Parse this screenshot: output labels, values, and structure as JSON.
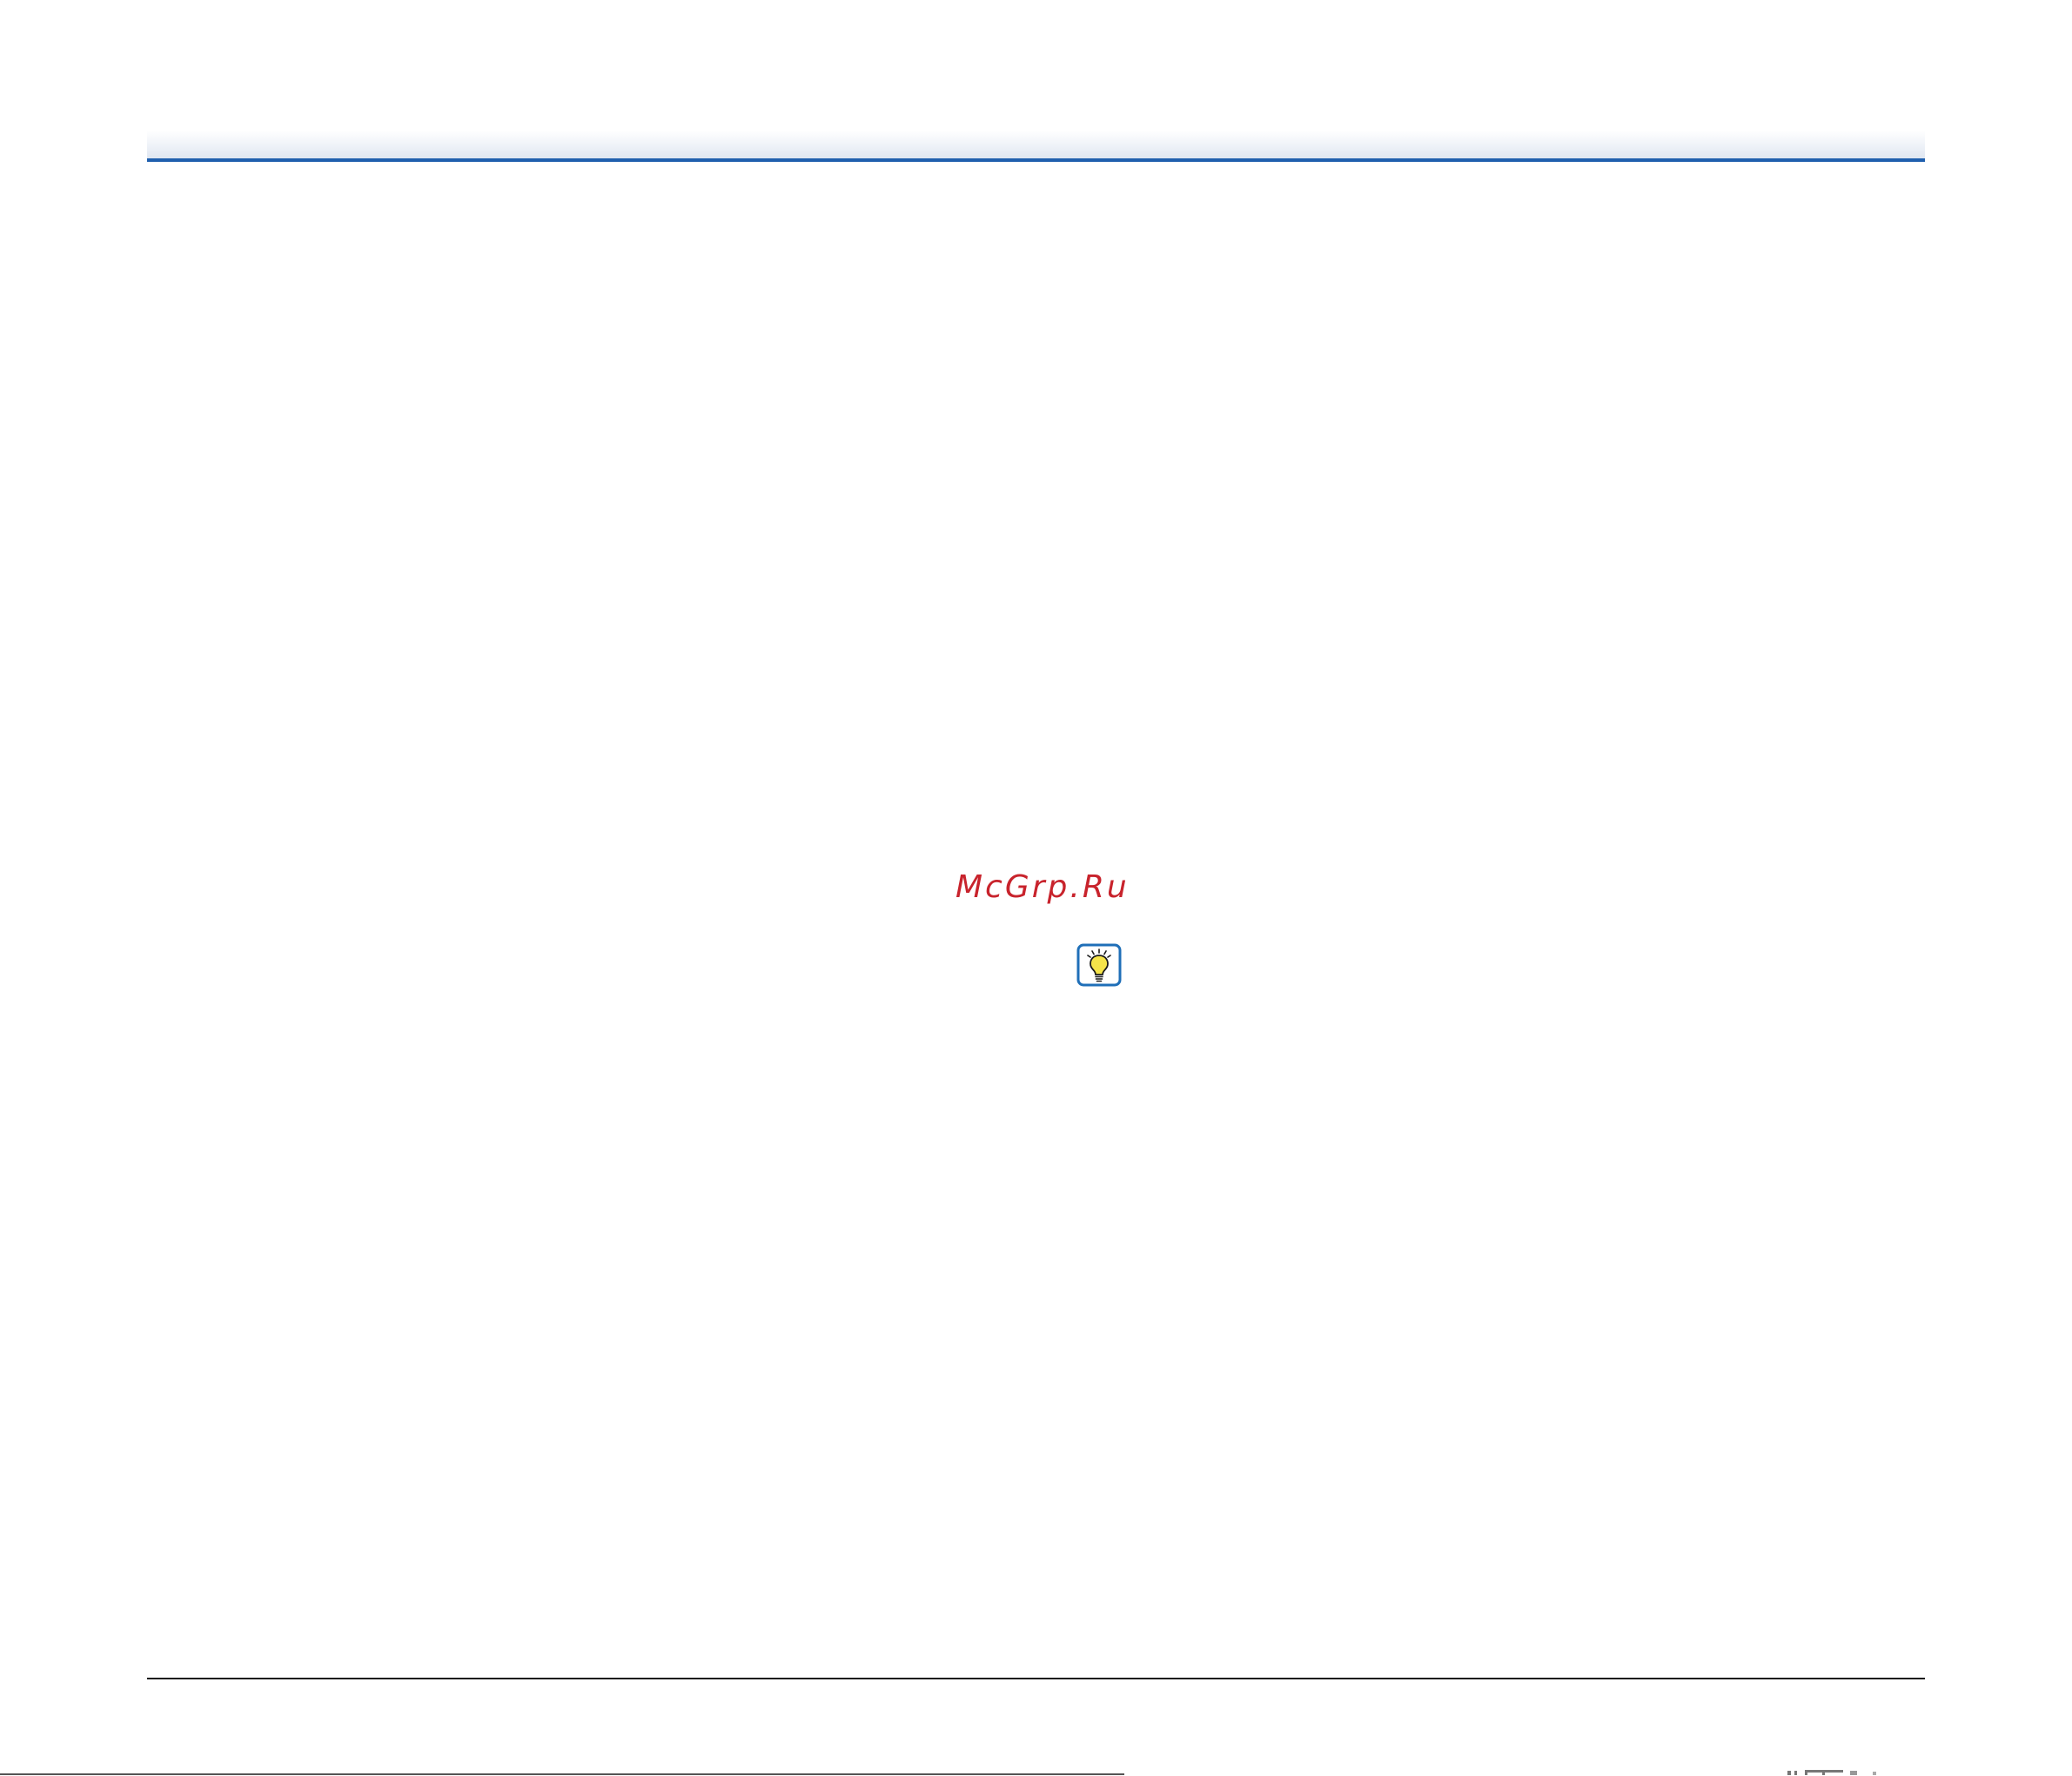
{
  "watermark": {
    "text": "McGrp.Ru",
    "color": "#c8232c"
  },
  "hint": {
    "icon": "lightbulb-icon"
  },
  "colors": {
    "header_rule": "#1f5fae",
    "icon_frame": "#1f6fb8",
    "icon_bulb": "#f5e44a"
  }
}
